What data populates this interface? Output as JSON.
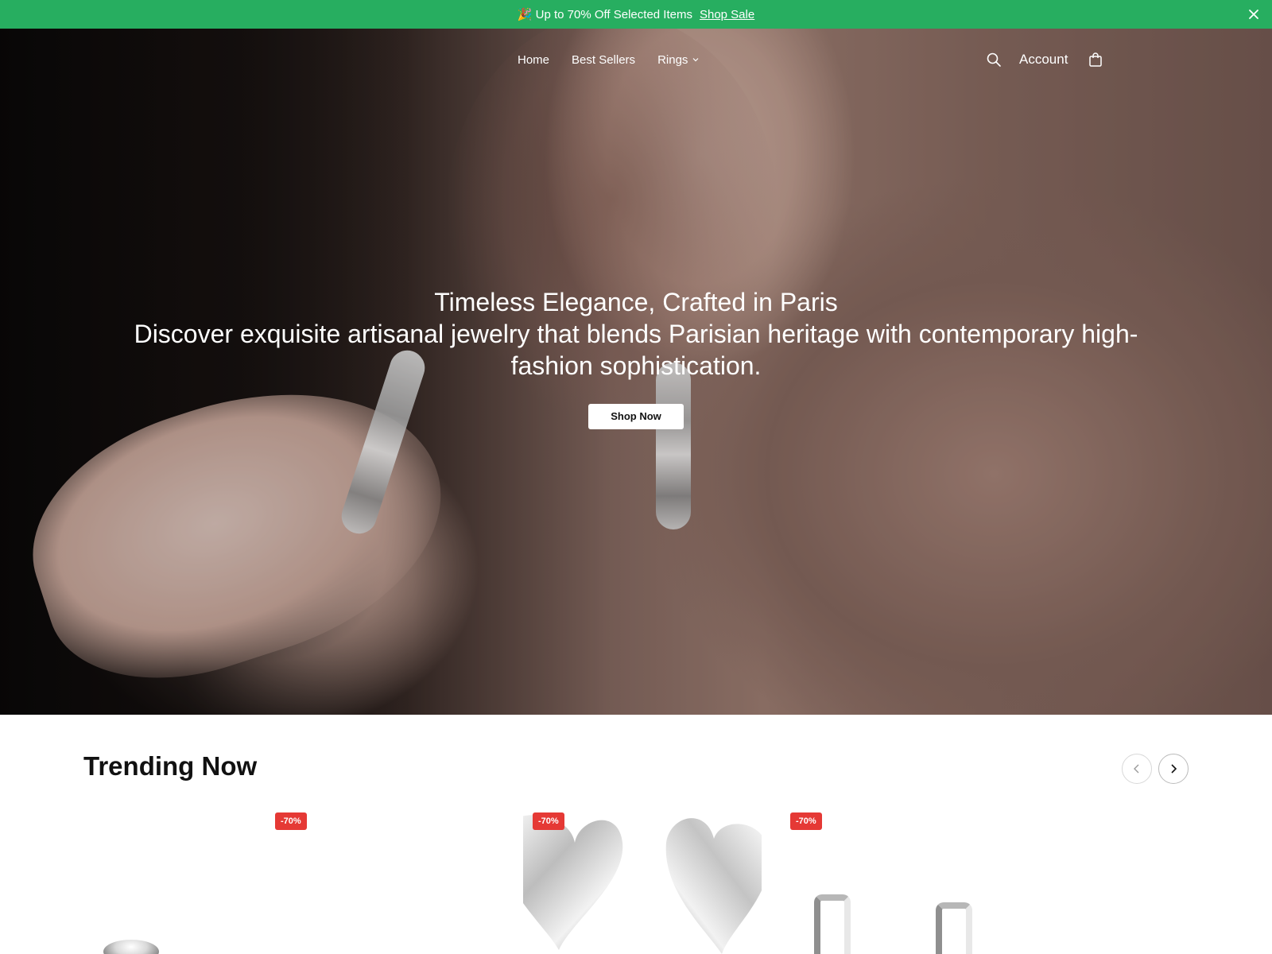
{
  "announcement": {
    "emoji": "🎉",
    "text": "Up to 70% Off Selected Items",
    "link_label": "Shop Sale"
  },
  "nav": {
    "items": [
      {
        "label": "Home"
      },
      {
        "label": "Best Sellers"
      },
      {
        "label": "Rings",
        "has_dropdown": true
      }
    ],
    "account_label": "Account",
    "icons": [
      "search-icon",
      "shopping-bag-icon",
      "close-icon",
      "chevron-down-icon"
    ]
  },
  "hero": {
    "title": "Timeless Elegance, Crafted in Paris",
    "subtitle": "Discover exquisite artisanal jewelry that blends Parisian heritage with contemporary high-fashion sophistication.",
    "cta_label": "Shop Now"
  },
  "trending": {
    "title": "Trending Now",
    "products": [
      {
        "badge": "-70%",
        "image": "round-diamond-stud"
      },
      {
        "badge": "-70%",
        "image": "silver-heart-earrings"
      },
      {
        "badge": "-70%",
        "image": "silver-huggie-hoops"
      }
    ]
  },
  "colors": {
    "announcement_bg": "#27ae60",
    "sale_badge": "#e53935",
    "text_dark": "#111111"
  }
}
